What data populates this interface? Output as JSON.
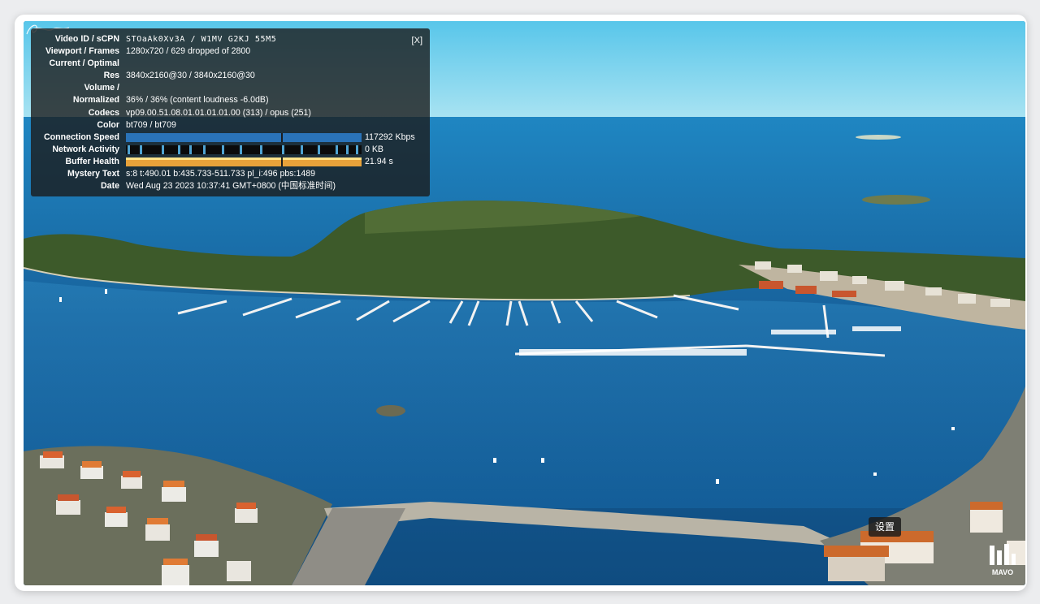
{
  "stats_panel": {
    "close_label": "[X]",
    "rows": [
      {
        "label": "Video ID / sCPN",
        "value": "STOaAk0Xv3A / W1MV G2KJ 55M5"
      },
      {
        "label": "Viewport / Frames",
        "value": "1280x720 / 629 dropped of 2800"
      },
      {
        "label": "Current / Optimal",
        "value": ""
      },
      {
        "label": "Res",
        "value": "3840x2160@30 / 3840x2160@30"
      },
      {
        "label": "Volume /",
        "value": ""
      },
      {
        "label": "Normalized",
        "value": "36% / 36% (content loudness -6.0dB)"
      },
      {
        "label": "Codecs",
        "value": "vp09.00.51.08.01.01.01.01.00 (313) / opus (251)"
      },
      {
        "label": "Color",
        "value": "bt709 / bt709"
      }
    ],
    "connection_speed": {
      "label": "Connection Speed",
      "value": "117292 Kbps",
      "fill_fraction": 1.0
    },
    "network_activity": {
      "label": "Network Activity",
      "value": "0 KB"
    },
    "buffer_health": {
      "label": "Buffer Health",
      "value": "21.94 s",
      "fill_fraction": 1.0
    },
    "rows_after": [
      {
        "label": "Mystery Text",
        "value": "s:8 t:490.01 b:435.733-511.733 pl_i:496 pbs:1489"
      },
      {
        "label": "Date",
        "value": "Wed Aug 23 2023 10:37:41 GMT+0800 (中国标准时间)"
      }
    ]
  },
  "settings_tooltip": "设置",
  "channel_logo_text": "MAVO",
  "colors": {
    "sky": "#6fd0ee",
    "sea_deep": "#0e4f86",
    "sea": "#1c79b8",
    "island": "#3f5a2c",
    "panel_bg": "#1c1c1c",
    "speed_bar": "#2a73b8",
    "buffer_bar": "#e8a23a"
  }
}
